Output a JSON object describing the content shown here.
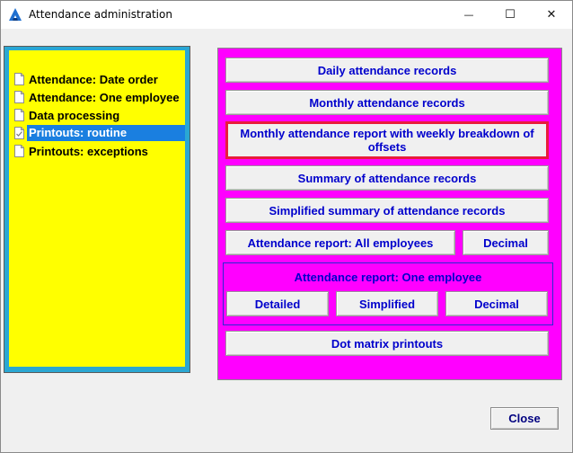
{
  "window": {
    "title": "Attendance administration",
    "minimize_glyph": "—",
    "maximize_glyph": "☐",
    "close_glyph": "✕"
  },
  "tree": {
    "items": [
      {
        "label": "Attendance: Date order",
        "icon": "document-icon",
        "selected": false
      },
      {
        "label": "Attendance: One employee",
        "icon": "document-icon",
        "selected": false
      },
      {
        "label": "Data processing",
        "icon": "document-icon",
        "selected": false
      },
      {
        "label": "Printouts: routine",
        "icon": "document-checked-icon",
        "selected": true
      },
      {
        "label": "Printouts: exceptions",
        "icon": "document-icon",
        "selected": false
      }
    ]
  },
  "panel": {
    "daily": "Daily attendance records",
    "monthly": "Monthly attendance records",
    "weekly": "Monthly attendance report with weekly breakdown of offsets",
    "summary": "Summary of attendance records",
    "simplified_summary": "Simplified summary of attendance records",
    "all_employees": "Attendance report: All employees",
    "all_decimal": "Decimal",
    "one_employee": {
      "title": "Attendance report: One employee",
      "detailed": "Detailed",
      "simplified": "Simplified",
      "decimal": "Decimal"
    },
    "dot_matrix": "Dot matrix printouts"
  },
  "footer": {
    "close": "Close"
  },
  "colors": {
    "tree_bg": "#ffff00",
    "panel_bg": "#ff00ff",
    "button_text": "#0000cc",
    "selection": "#1a7fe0",
    "highlight_border": "#e81c3c"
  }
}
